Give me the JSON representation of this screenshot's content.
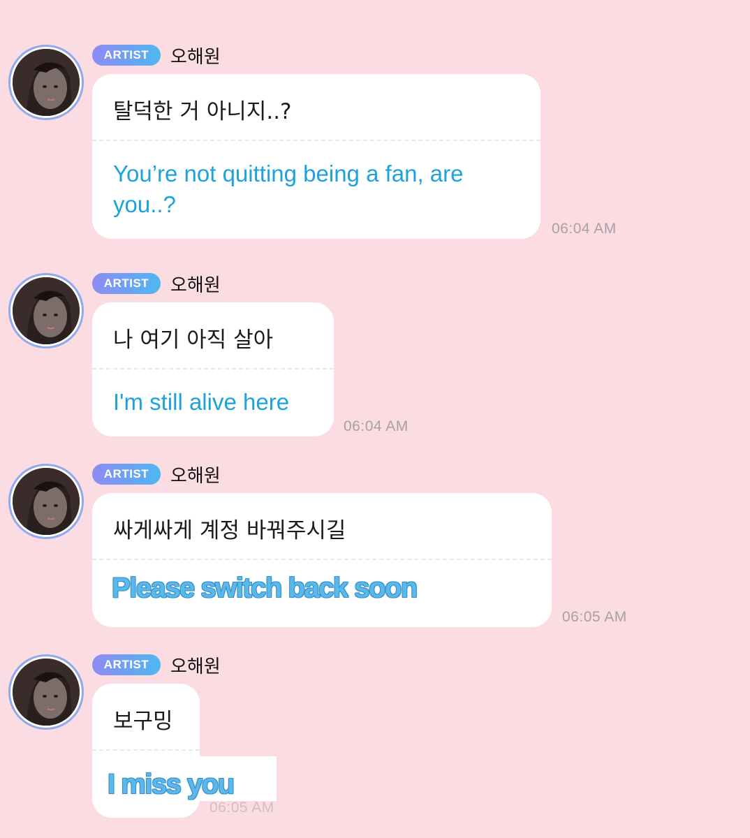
{
  "messages": [
    {
      "badge": "ARTIST",
      "sender": "오해원",
      "korean": "탈덕한 거 아니지..?",
      "english": "You’re not quitting being a fan, are you..?",
      "time": "06:04 AM"
    },
    {
      "badge": "ARTIST",
      "sender": "오해원",
      "korean": "나 여기 아직 살아",
      "english": "I'm still alive here",
      "time": "06:04 AM"
    },
    {
      "badge": "ARTIST",
      "sender": "오해원",
      "korean": "싸게싸게 계정 바꿔주시길",
      "english": "Please switch back soon",
      "time": "06:05 AM"
    },
    {
      "badge": "ARTIST",
      "sender": "오해원",
      "korean": "보구밍",
      "english": "I miss you",
      "time": "06:05 AM"
    }
  ],
  "colors": {
    "background": "#fadce2",
    "bubble": "#ffffff",
    "translation": "#1ea2dc",
    "badge_start": "#8f8af2",
    "badge_end": "#4fb7f0"
  }
}
